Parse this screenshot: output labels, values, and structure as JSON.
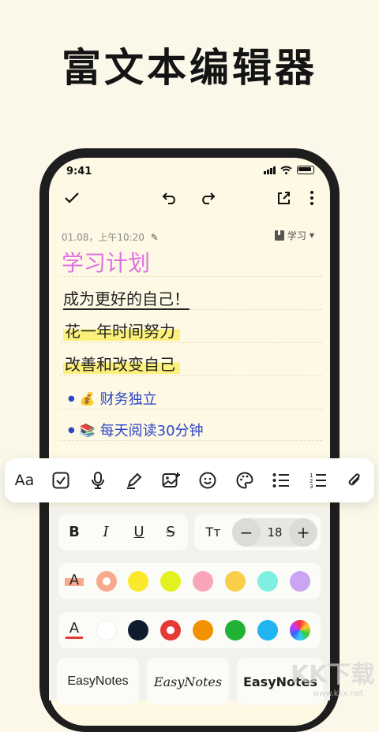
{
  "headline": "富文本编辑器",
  "status": {
    "time": "9:41"
  },
  "toolbar": {
    "done_icon": "check-icon",
    "undo_icon": "undo-icon",
    "redo_icon": "redo-icon",
    "share_icon": "share-icon",
    "more_icon": "more-vertical-icon"
  },
  "note": {
    "meta": "01.08，上午10:20",
    "notebook": "学习",
    "title": "学习计划",
    "lines": [
      "成为更好的自己！",
      "花一年时间努力",
      "改善和改变自己"
    ],
    "bullets": [
      {
        "emoji": "💰",
        "text": "财务独立"
      },
      {
        "emoji": "📚",
        "text": "每天阅读30分钟"
      }
    ]
  },
  "format_bar": {
    "font_label": "Aa",
    "icons": [
      "font-icon",
      "checkbox-icon",
      "microphone-icon",
      "pen-icon",
      "image-add-icon",
      "emoji-icon",
      "palette-icon",
      "bulleted-list-icon",
      "numbered-list-icon",
      "attachment-icon"
    ]
  },
  "panel": {
    "bold": "B",
    "italic": "I",
    "underline": "U",
    "strike": "S",
    "size_icon": "Tт",
    "minus": "−",
    "size": "18",
    "plus": "+",
    "highlight_colors": [
      "#F7A98E",
      "#FAE82A",
      "#E3F21F",
      "#F8A5B8",
      "#F7CF4A",
      "#7EEFE0",
      "#C9A5F2"
    ],
    "text_colors": [
      "#FFFFFF",
      "#0F1C2E",
      "#E53935",
      "#F39200",
      "#20B234",
      "#21B4F2",
      "#rainbow"
    ],
    "fonts": [
      "EasyNotes",
      "EasyNotes",
      "EasyNotes"
    ]
  },
  "watermark": {
    "main": "KK下载",
    "sub": "www.kkx.net"
  }
}
